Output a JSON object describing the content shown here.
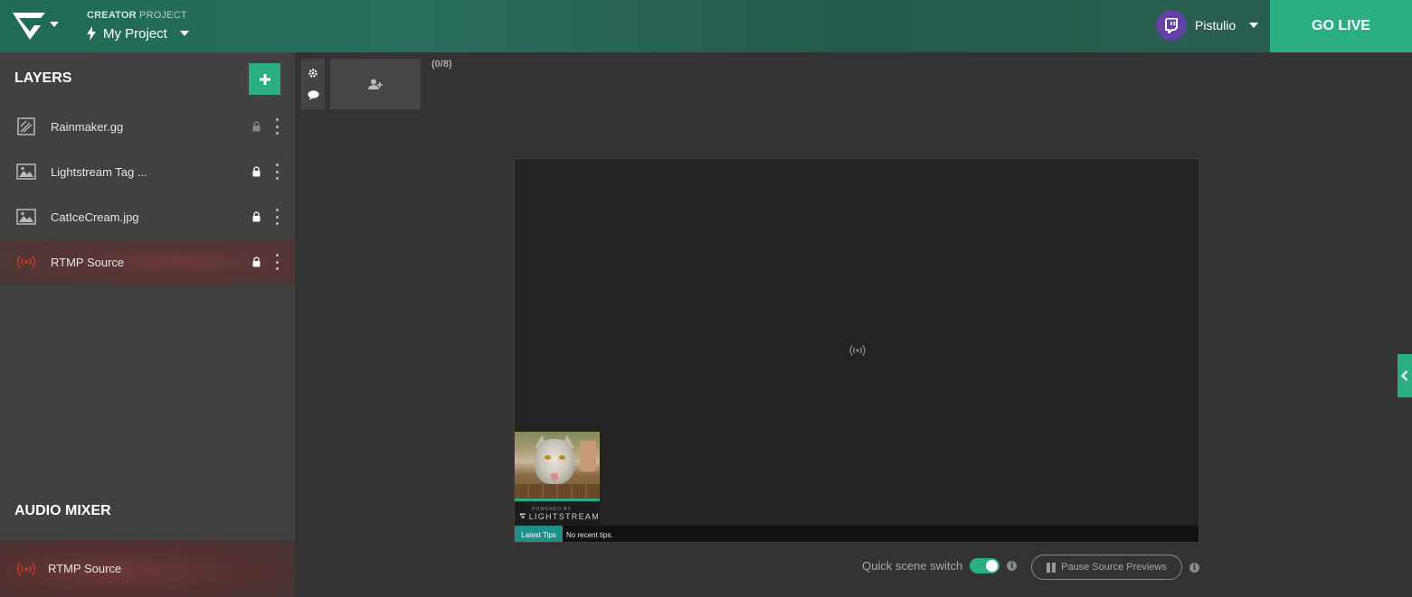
{
  "header": {
    "project_kind_strong": "CREATOR",
    "project_kind_rest": " PROJECT",
    "project_name": "My Project",
    "user_name": "Pistulio",
    "go_live_label": "GO LIVE"
  },
  "sidebar": {
    "layers_title": "LAYERS",
    "layers": [
      {
        "label": "Rainmaker.gg",
        "icon": "rainmaker-icon",
        "locked": true,
        "active": false
      },
      {
        "label": "Lightstream Tag ...",
        "icon": "image-icon",
        "locked": true,
        "active": false
      },
      {
        "label": "CatIceCream.jpg",
        "icon": "image-icon",
        "locked": true,
        "active": false
      },
      {
        "label": "RTMP Source",
        "icon": "broadcast-icon",
        "locked": true,
        "active": true
      }
    ],
    "audio_title": "AUDIO MIXER",
    "audio_sources": [
      {
        "label": "RTMP Source",
        "icon": "broadcast-icon"
      }
    ]
  },
  "scenes": {
    "count_label": "(0/8)"
  },
  "canvas": {
    "overlay_brand_small": "POWERED BY",
    "overlay_brand": "LIGHTSTREAM",
    "tips_tag": "Latest Tips",
    "tips_message": "No recent tips."
  },
  "footer": {
    "quick_scene_switch_label": "Quick scene switch",
    "quick_scene_switch_on": true,
    "pause_previews_label": "Pause Source Previews"
  },
  "colors": {
    "accent": "#2bae83",
    "twitch": "#6441a5",
    "rtmp_red": "#c0392b"
  }
}
